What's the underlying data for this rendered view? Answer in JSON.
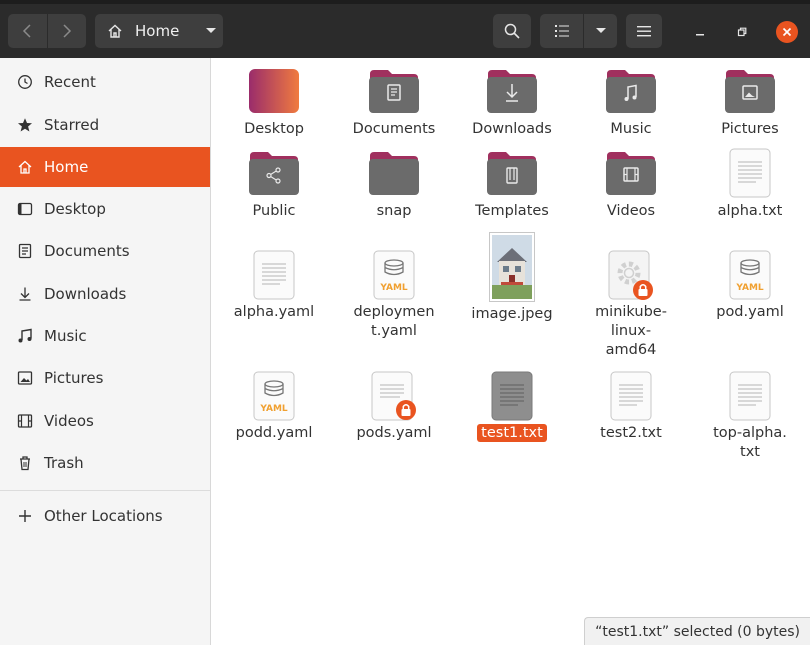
{
  "header": {
    "path_label": "Home"
  },
  "sidebar": {
    "items": [
      {
        "label": "Recent"
      },
      {
        "label": "Starred"
      },
      {
        "label": "Home"
      },
      {
        "label": "Desktop"
      },
      {
        "label": "Documents"
      },
      {
        "label": "Downloads"
      },
      {
        "label": "Music"
      },
      {
        "label": "Pictures"
      },
      {
        "label": "Videos"
      },
      {
        "label": "Trash"
      },
      {
        "label": "Other Locations"
      }
    ]
  },
  "files": {
    "items": [
      {
        "name": "Desktop",
        "type": "folder-desktop"
      },
      {
        "name": "Documents",
        "type": "folder-documents"
      },
      {
        "name": "Downloads",
        "type": "folder-downloads"
      },
      {
        "name": "Music",
        "type": "folder-music"
      },
      {
        "name": "Pictures",
        "type": "folder-pictures"
      },
      {
        "name": "Public",
        "type": "folder-public"
      },
      {
        "name": "snap",
        "type": "folder"
      },
      {
        "name": "Templates",
        "type": "folder-templates"
      },
      {
        "name": "Videos",
        "type": "folder-videos"
      },
      {
        "name": "alpha.txt",
        "type": "text-file"
      },
      {
        "name": "alpha.yaml",
        "type": "text-file"
      },
      {
        "name_line1": "deploymen",
        "name_line2": "t.yaml",
        "type": "yaml-file"
      },
      {
        "name": "image.jpeg",
        "type": "image-file"
      },
      {
        "name_line1": "minikube-",
        "name_line2": "linux-",
        "name_line3": "amd64",
        "type": "executable-locked"
      },
      {
        "name": "pod.yaml",
        "type": "yaml-file"
      },
      {
        "name": "podd.yaml",
        "type": "yaml-file"
      },
      {
        "name": "pods.yaml",
        "type": "text-file-locked"
      },
      {
        "name": "test1.txt",
        "type": "text-file-selected"
      },
      {
        "name": "test2.txt",
        "type": "text-file"
      },
      {
        "name_line1": "top-alpha.",
        "name_line2": "txt",
        "type": "text-file"
      }
    ],
    "yaml_badge": "YAML"
  },
  "status": {
    "text": "“test1.txt” selected  (0 bytes)"
  },
  "colors": {
    "accent": "#e95420",
    "header_bg": "#2b2b2b",
    "folder_tab": "#a0305e",
    "folder_body": "#6b6b6b"
  }
}
